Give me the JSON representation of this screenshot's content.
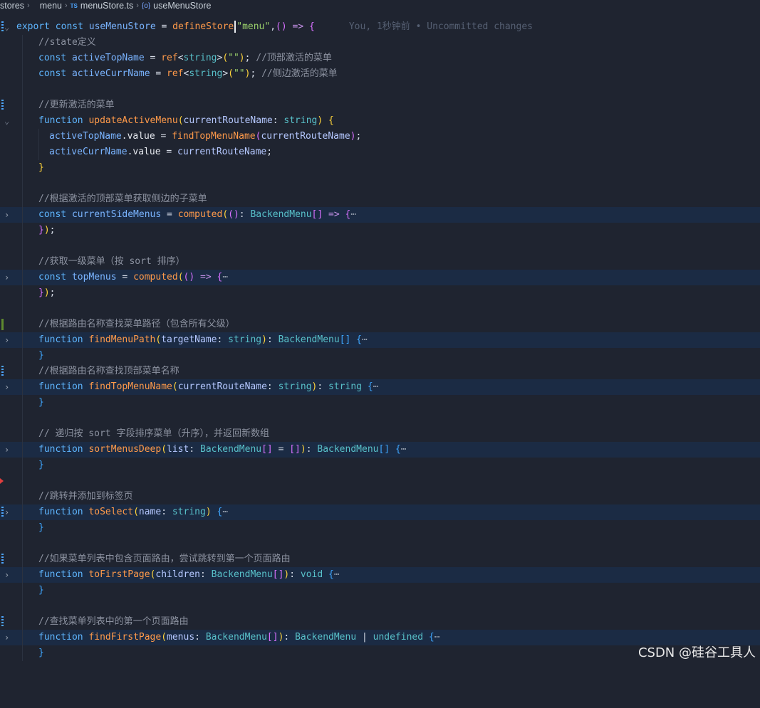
{
  "breadcrumb": [
    "stores",
    "menu",
    "menuStore.ts",
    "useMenuStore"
  ],
  "breadcrumb_icons": {
    "ts": "TS",
    "symbol": "{o}"
  },
  "blame": "You, 1秒钟前 • Uncommitted changes",
  "code": {
    "l1_kw": "export const",
    "l1_name": "useMenuStore",
    "l1_fn": "defineStore",
    "l1_str": "\"menu\"",
    "c_state": "//state定义",
    "activeTopName": "activeTopName",
    "activeCurrName": "activeCurrName",
    "ref": "ref",
    "string": "string",
    "empty_str": "\"\"",
    "c_top": "//顶部激活的菜单",
    "c_side": "//侧边激活的菜单",
    "c_update": "//更新激活的菜单",
    "updateActiveMenu": "updateActiveMenu",
    "currentRouteName": "currentRouteName",
    "value": "value",
    "findTopMenuName": "findTopMenuName",
    "c_sub": "//根据激活的顶部菜单获取侧边的子菜单",
    "currentSideMenus": "currentSideMenus",
    "computed": "computed",
    "BackendMenu": "BackendMenu",
    "c_toplevel": "//获取一级菜单（按 sort 排序）",
    "topMenus": "topMenus",
    "c_path": "//根据路由名称查找菜单路径（包含所有父级）",
    "findMenuPath": "findMenuPath",
    "targetName": "targetName",
    "c_topname": "//根据路由名称查找顶部菜单名称",
    "c_sort": "// 递归按 sort 字段排序菜单（升序），并返回新数组",
    "sortMenusDeep": "sortMenusDeep",
    "list": "list",
    "c_select": "//跳转并添加到标签页",
    "toSelect": "toSelect",
    "name": "name",
    "c_first": "//如果菜单列表中包含页面路由，尝试跳转到第一个页面路由",
    "toFirstPage": "toFirstPage",
    "children": "children",
    "void": "void",
    "c_findfirst": "//查找菜单列表中的第一个页面路由",
    "findFirstPage": "findFirstPage",
    "menus": "menus",
    "undefined": "undefined",
    "function": "function",
    "const": "const",
    "ellipsis": "⋯"
  },
  "watermark": "CSDN @硅谷工具人"
}
